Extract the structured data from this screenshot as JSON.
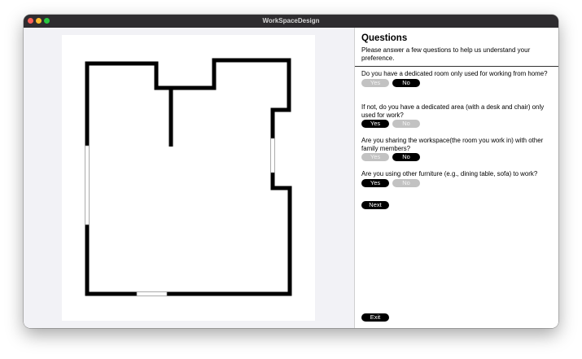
{
  "window": {
    "title": "WorkSpaceDesign"
  },
  "panel": {
    "title": "Questions",
    "subtitle": "Please answer a few questions to help us understand your preference."
  },
  "questions": [
    {
      "text": "Do you have a dedicated room only used for working from home?",
      "yes_label": "Yes",
      "no_label": "No",
      "selected": "No"
    },
    {
      "text": "If not, do you have a dedicated area (with a desk and chair) only used for work?",
      "yes_label": "Yes",
      "no_label": "No",
      "selected": "Yes"
    },
    {
      "text": "Are you sharing the workspace(the room you work in) with other family members?",
      "yes_label": "Yes",
      "no_label": "No",
      "selected": "No"
    },
    {
      "text": "Are you using other furniture (e.g., dining table, sofa) to work?",
      "yes_label": "Yes",
      "no_label": "No",
      "selected": "Yes"
    }
  ],
  "buttons": {
    "next": "Next",
    "exit": "Exit"
  },
  "colors": {
    "active_button": "#000000",
    "inactive_button": "#c2c2c2",
    "wall": "#000000"
  }
}
